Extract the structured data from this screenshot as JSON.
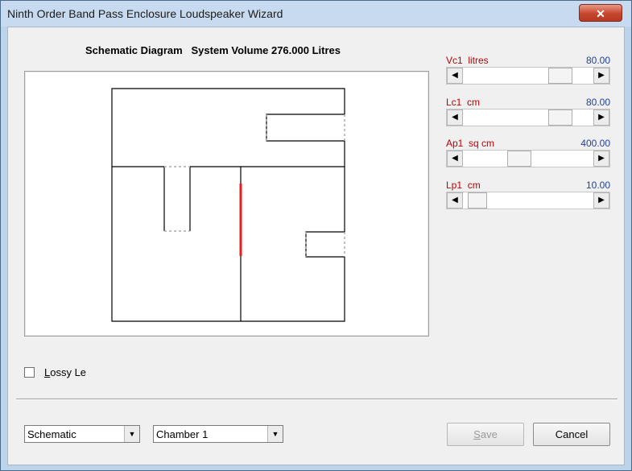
{
  "window": {
    "title": "Ninth Order Band Pass Enclosure Loudspeaker Wizard",
    "close_glyph": "✕"
  },
  "diagram": {
    "heading_left": "Schematic Diagram",
    "heading_right": "System Volume 276.000 Litres",
    "driver_color": "#e81c1c"
  },
  "parameters": [
    {
      "label": "Vc1  litres",
      "value": "80.00",
      "position_fraction": 0.79
    },
    {
      "label": "Lc1  cm",
      "value": "80.00",
      "position_fraction": 0.79
    },
    {
      "label": "Ap1  sq cm",
      "value": "400.00",
      "position_fraction": 0.41
    },
    {
      "label": "Lp1  cm",
      "value": "10.00",
      "position_fraction": 0.04
    }
  ],
  "scroll": {
    "left_glyph": "◀",
    "right_glyph": "▶"
  },
  "options": {
    "lossy_le_label_mnemonic": "L",
    "lossy_le_label_rest": "ossy Le",
    "lossy_le_checked": false
  },
  "footer": {
    "view_select_value": "Schematic",
    "chamber_select_value": "Chamber 1",
    "dropdown_glyph": "▼",
    "save_mnemonic": "S",
    "save_rest": "ave",
    "cancel_label": "Cancel"
  },
  "colors": {
    "label_red": "#c00000",
    "value_blue": "#1f3f9f"
  }
}
